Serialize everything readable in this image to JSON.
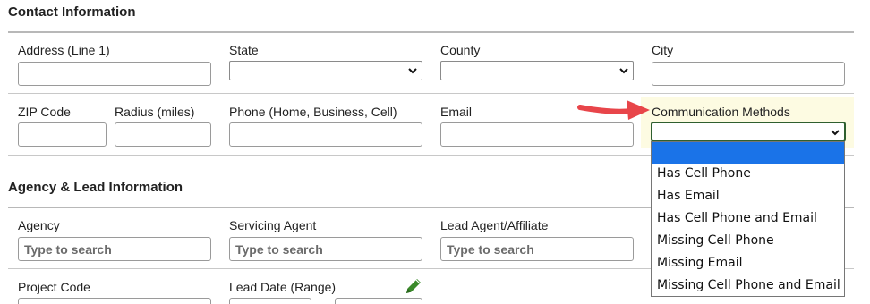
{
  "contact": {
    "title": "Contact Information",
    "address_label": "Address (Line 1)",
    "state_label": "State",
    "county_label": "County",
    "city_label": "City",
    "zip_label": "ZIP Code",
    "radius_label": "Radius (miles)",
    "phone_label": "Phone (Home, Business, Cell)",
    "email_label": "Email",
    "comm_label": "Communication Methods"
  },
  "comm_dropdown": {
    "options": [
      "",
      "Has Cell Phone",
      "Has Email",
      "Has Cell Phone and Email",
      "Missing Cell Phone",
      "Missing Email",
      "Missing Cell Phone and Email"
    ]
  },
  "agency": {
    "title": "Agency & Lead Information",
    "agency_label": "Agency",
    "agency_placeholder": "Type to search",
    "servicing_label": "Servicing Agent",
    "servicing_placeholder": "Type to search",
    "lead_agent_label": "Lead Agent/Affiliate",
    "lead_agent_placeholder": "Type to search",
    "project_code_label": "Project Code",
    "lead_date_label": "Lead Date (Range)"
  },
  "icons": {
    "annotation": "red-arrow-icon",
    "edit": "pencil-icon",
    "select_caret": "chevron-down-icon"
  },
  "colors": {
    "highlight": "#fdfbe2",
    "focus_border": "#2f5f2f",
    "selected_option": "#1a73e8",
    "arrow": "#e8454a",
    "pencil": "#3a8a2a"
  }
}
